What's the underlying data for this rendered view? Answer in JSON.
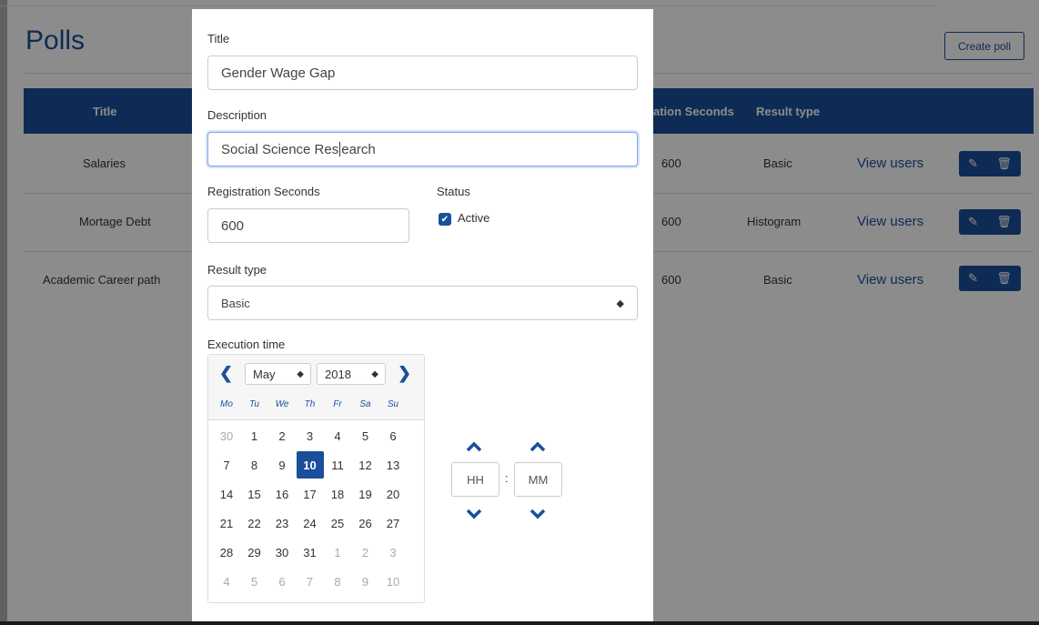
{
  "page": {
    "title": "Polls",
    "create_button": "Create poll",
    "table": {
      "headers": [
        "Title",
        "ation Seconds",
        "Result type"
      ],
      "rows": [
        {
          "title": "Salaries",
          "seconds": "600",
          "result_type": "Basic",
          "link": "View users"
        },
        {
          "title": "Mortage Debt",
          "seconds": "600",
          "result_type": "Histogram",
          "link": "View users"
        },
        {
          "title": "Academic Career path",
          "seconds": "600",
          "result_type": "Basic",
          "link": "View users"
        }
      ]
    }
  },
  "form": {
    "title_label": "Title",
    "title_value": "Gender Wage Gap",
    "description_label": "Description",
    "description_before_caret": "Social Science Res",
    "description_after_caret": "earch",
    "registration_label": "Registration Seconds",
    "registration_value": "600",
    "status_label": "Status",
    "status_checked": true,
    "status_option": "Active",
    "result_type_label": "Result type",
    "result_type_value": "Basic",
    "execution_label": "Execution time"
  },
  "calendar": {
    "month": "May",
    "year": "2018",
    "weekdays": [
      "Mo",
      "Tu",
      "We",
      "Th",
      "Fr",
      "Sa",
      "Su"
    ],
    "selected_day": "10",
    "weeks": [
      [
        [
          "30",
          true
        ],
        [
          "1",
          false
        ],
        [
          "2",
          false
        ],
        [
          "3",
          false
        ],
        [
          "4",
          false
        ],
        [
          "5",
          false
        ],
        [
          "6",
          false
        ]
      ],
      [
        [
          "7",
          false
        ],
        [
          "8",
          false
        ],
        [
          "9",
          false
        ],
        [
          "10",
          false
        ],
        [
          "11",
          false
        ],
        [
          "12",
          false
        ],
        [
          "13",
          false
        ]
      ],
      [
        [
          "14",
          false
        ],
        [
          "15",
          false
        ],
        [
          "16",
          false
        ],
        [
          "17",
          false
        ],
        [
          "18",
          false
        ],
        [
          "19",
          false
        ],
        [
          "20",
          false
        ]
      ],
      [
        [
          "21",
          false
        ],
        [
          "22",
          false
        ],
        [
          "23",
          false
        ],
        [
          "24",
          false
        ],
        [
          "25",
          false
        ],
        [
          "26",
          false
        ],
        [
          "27",
          false
        ]
      ],
      [
        [
          "28",
          false
        ],
        [
          "29",
          false
        ],
        [
          "30",
          false
        ],
        [
          "31",
          false
        ],
        [
          "1",
          true
        ],
        [
          "2",
          true
        ],
        [
          "3",
          true
        ]
      ],
      [
        [
          "4",
          true
        ],
        [
          "5",
          true
        ],
        [
          "6",
          true
        ],
        [
          "7",
          true
        ],
        [
          "8",
          true
        ],
        [
          "9",
          true
        ],
        [
          "10",
          true
        ]
      ]
    ]
  },
  "time": {
    "hours_placeholder": "HH",
    "minutes_placeholder": "MM",
    "separator": ":"
  },
  "colors": {
    "accent": "#1b4f9c"
  }
}
